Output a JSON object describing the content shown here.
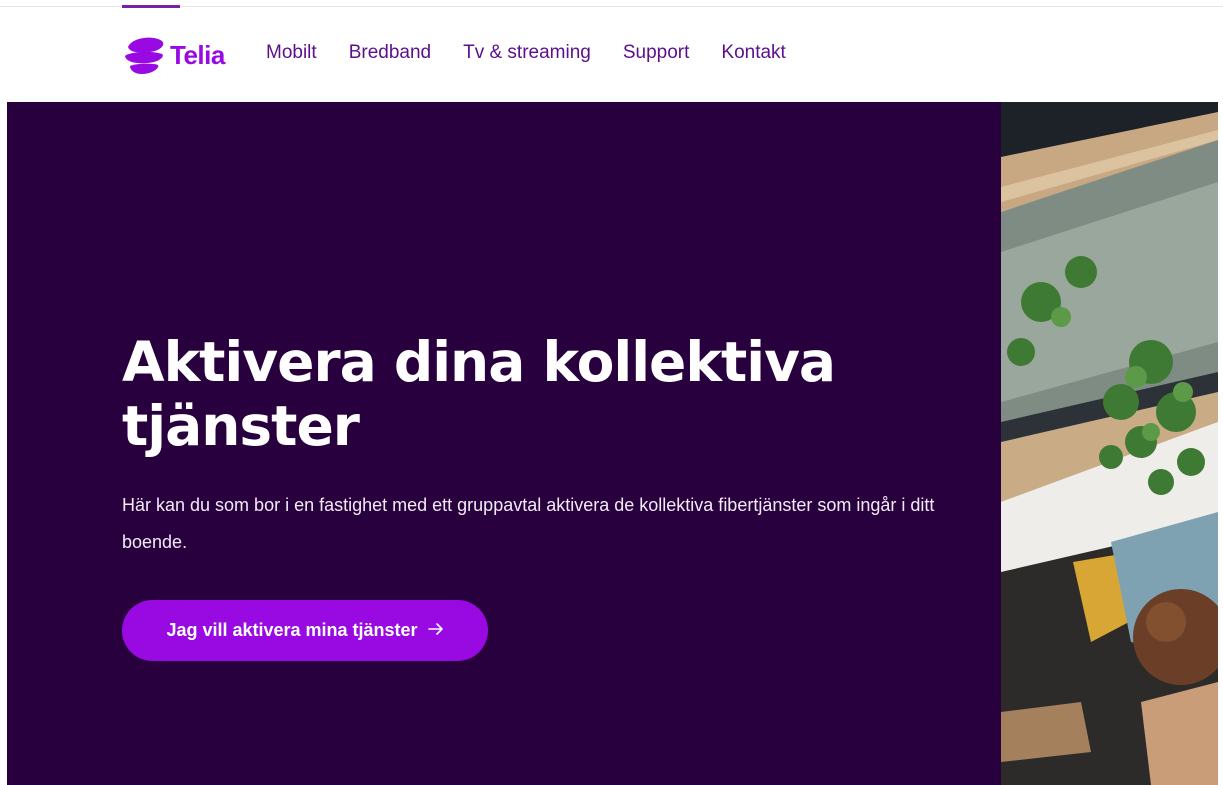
{
  "header": {
    "logo_text": "Telia",
    "nav": [
      {
        "label": "Mobilt"
      },
      {
        "label": "Bredband"
      },
      {
        "label": "Tv & streaming"
      },
      {
        "label": "Support"
      },
      {
        "label": "Kontakt"
      }
    ]
  },
  "hero": {
    "title": "Aktivera dina kollektiva tjänster",
    "description": "Här kan du som bor i en fastighet med ett gruppavtal aktivera de kollektiva fibertjänster som ingår i ditt boende.",
    "cta_label": "Jag vill aktivera mina tjänster"
  },
  "colors": {
    "brand_purple": "#990ae3",
    "hero_background": "#29003e",
    "nav_text": "#5c0f8b"
  },
  "icons": {
    "logo": "telia-pebble-icon",
    "cta": "arrow-right-icon"
  }
}
